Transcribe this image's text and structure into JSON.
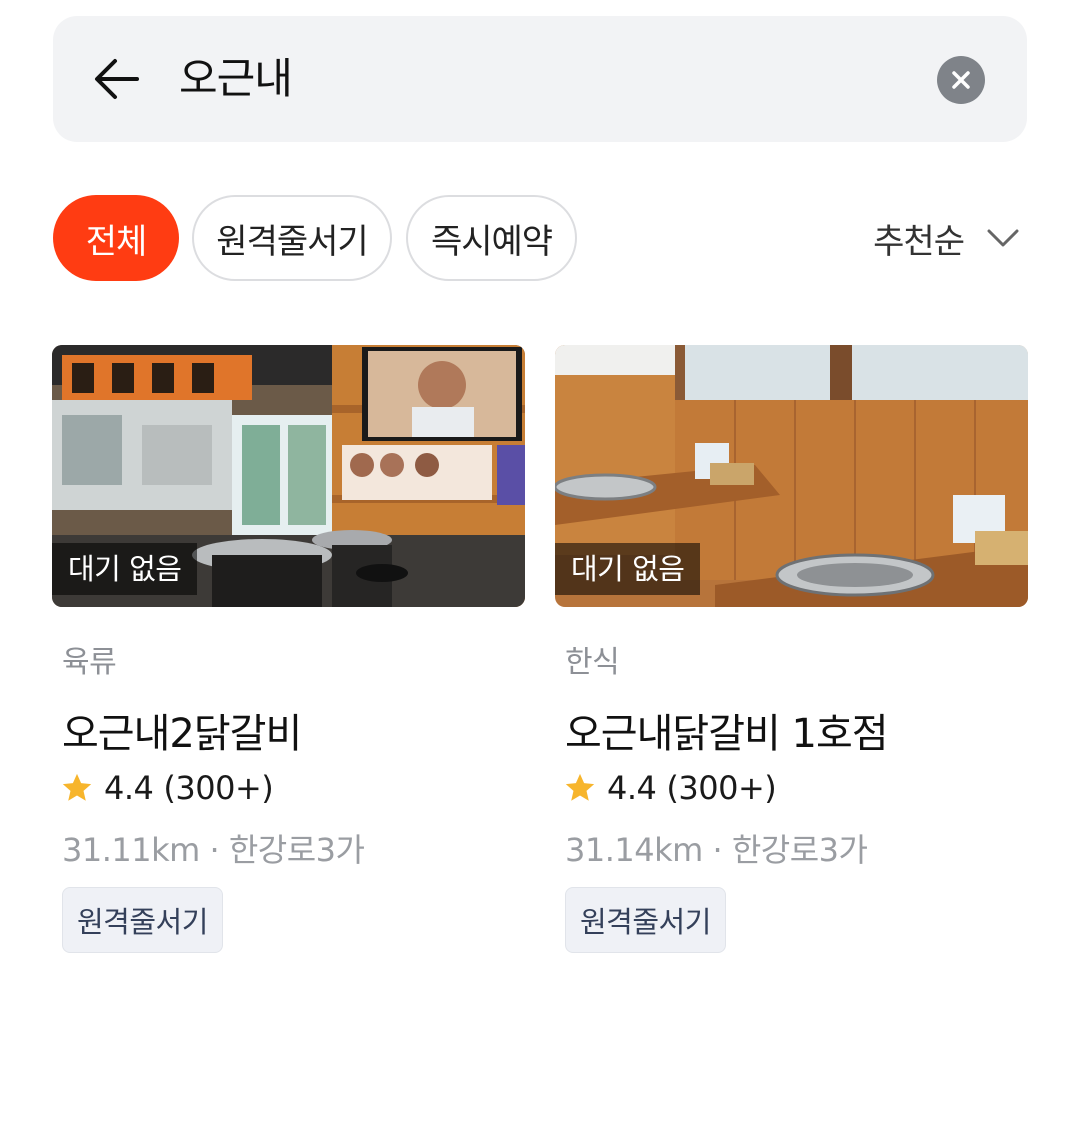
{
  "search": {
    "query": "오근내"
  },
  "filters": {
    "chips": [
      {
        "label": "전체",
        "active": true
      },
      {
        "label": "원격줄서기",
        "active": false
      },
      {
        "label": "즉시예약",
        "active": false
      }
    ],
    "sort_label": "추천순"
  },
  "colors": {
    "accent": "#ff3c12",
    "star": "#f7b52c",
    "search_bg": "#f2f3f5"
  },
  "results": [
    {
      "badge": "대기 없음",
      "category": "육류",
      "name": "오근내2닭갈비",
      "rating": "4.4",
      "reviews": "(300+)",
      "distance": "31.11km",
      "area": "한강로3가",
      "tag": "원격줄서기"
    },
    {
      "badge": "대기 없음",
      "category": "한식",
      "name": "오근내닭갈비 1호점",
      "rating": "4.4",
      "reviews": "(300+)",
      "distance": "31.14km",
      "area": "한강로3가",
      "tag": "원격줄서기"
    }
  ],
  "separator": "·"
}
